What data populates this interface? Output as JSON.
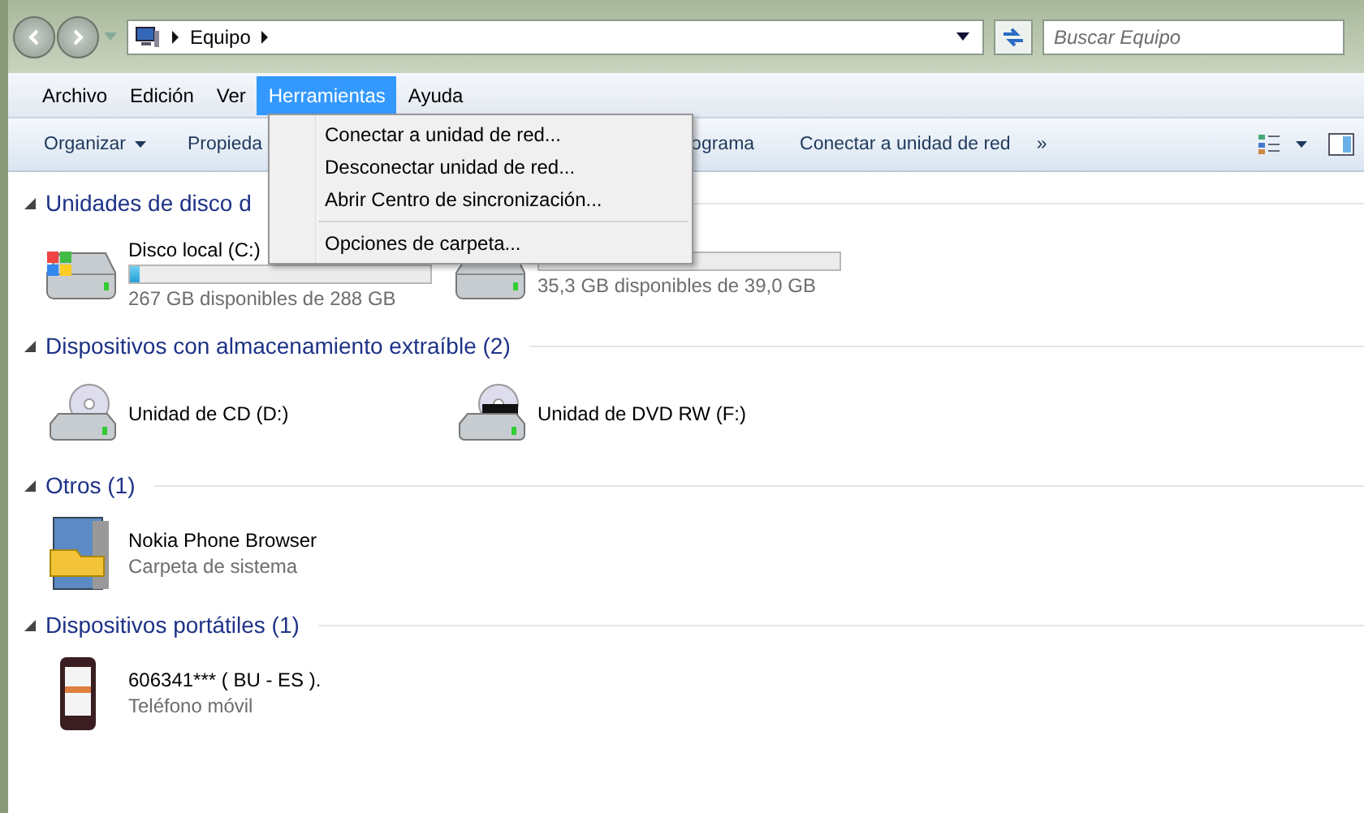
{
  "address_bar": {
    "crumbs": [
      "Equipo"
    ]
  },
  "search": {
    "placeholder": "Buscar Equipo"
  },
  "menu_bar": [
    {
      "label": "Archivo",
      "selected": false
    },
    {
      "label": "Edición",
      "selected": false
    },
    {
      "label": "Ver",
      "selected": false
    },
    {
      "label": "Herramientas",
      "selected": true
    },
    {
      "label": "Ayuda",
      "selected": false
    }
  ],
  "toolbar": [
    {
      "label": "Organizar",
      "dropdown": true
    },
    {
      "label": "Propieda"
    },
    {
      "label": "ograma"
    },
    {
      "label": "Conectar a unidad de red"
    }
  ],
  "toolbar_more": "»",
  "open_menu": [
    {
      "label": "Conectar a unidad de red..."
    },
    {
      "label": "Desconectar unidad de red..."
    },
    {
      "label": "Abrir Centro de sincronización..."
    },
    {
      "kind": "separator"
    },
    {
      "label": "Opciones de carpeta..."
    }
  ],
  "groups": [
    {
      "title": "Unidades de disco d",
      "items": [
        {
          "kind": "hdd",
          "name": "Disco local (C:)",
          "level": 0.03,
          "detail": "267 GB disponibles de 288 GB"
        },
        {
          "kind": "hdd",
          "detail": "35,3 GB disponibles de 39,0 GB"
        }
      ]
    },
    {
      "title": "Dispositivos con almacenamiento extraíble (2)",
      "items": [
        {
          "kind": "cd",
          "name": "Unidad de CD (D:)"
        },
        {
          "kind": "dvd",
          "name": "Unidad de DVD RW (F:)"
        }
      ]
    },
    {
      "title": "Otros (1)",
      "items": [
        {
          "kind": "folder",
          "name": "Nokia Phone Browser",
          "detail": "Carpeta de sistema"
        }
      ]
    },
    {
      "title": "Dispositivos portátiles (1)",
      "items": [
        {
          "kind": "phone",
          "name": "606341*** ( BU - ES ).",
          "detail": "Teléfono móvil"
        }
      ]
    }
  ]
}
